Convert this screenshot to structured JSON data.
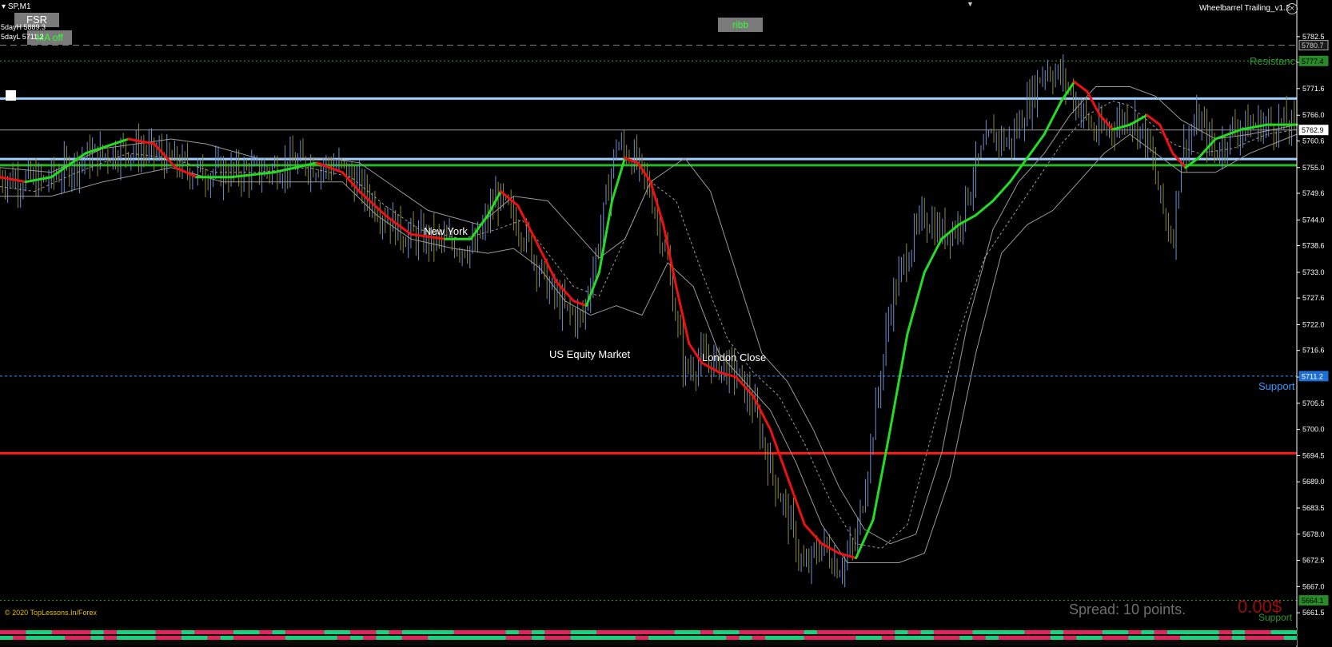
{
  "window": {
    "symbol": "SP,M1",
    "indicator_title": "Wheelbarrel Trailing_v1.2"
  },
  "buttons": {
    "fsr": "FSR",
    "ma_off": "MA off",
    "ribb": "ribb"
  },
  "stats": {
    "five_day_high": "5dayH 5889.3",
    "five_day_low": "5dayL 5711.2"
  },
  "sessions": {
    "new_york": "New York",
    "us_equity": "US Equity Market",
    "london_close": "London Close"
  },
  "levels": {
    "resistance": "Resistance",
    "support": "Support",
    "support_bottom": "Support"
  },
  "footer": {
    "copyright": "© 2020 TopLessons.In/Forex",
    "spread": "Spread: 10 points.",
    "pnl": "0.00$"
  },
  "colors": {
    "bg": "#000000",
    "up_candle": "#6f8fcf",
    "down_candle": "#8c8a32",
    "ma_up": "#22dd22",
    "ma_down": "#ee1111",
    "level_blue": "#9fd0ff",
    "level_green": "#22bb22",
    "level_red": "#ff1a1a",
    "support_blue": "#3399ff",
    "resistance_green": "#2e9a2e"
  },
  "chart_data": {
    "type": "line",
    "symbol": "SP",
    "timeframe": "M1",
    "ylim": [
      5658.5,
      5785.5
    ],
    "y_ticks": [
      5782.5,
      5777.1,
      5771.6,
      5766.0,
      5760.6,
      5755.0,
      5749.6,
      5744.0,
      5738.6,
      5733.0,
      5727.6,
      5722.0,
      5716.6,
      5711.0,
      5705.5,
      5700.0,
      5694.5,
      5689.0,
      5683.5,
      5678.0,
      5672.5,
      5667.0,
      5661.5
    ],
    "price_tags": [
      {
        "value": 5780.7,
        "label": "5780.7",
        "style": "dark"
      },
      {
        "value": 5777.4,
        "label": "5777.4",
        "style": "green"
      },
      {
        "value": 5762.9,
        "label": "5762.9",
        "style": "white"
      },
      {
        "value": 5711.2,
        "label": "5711.2",
        "style": "blue"
      },
      {
        "value": 5664.1,
        "label": "5664.1",
        "style": "green"
      }
    ],
    "horizontal_levels": [
      {
        "value": 5780.7,
        "style": "dash-gray"
      },
      {
        "value": 5777.4,
        "style": "dot-green"
      },
      {
        "value": 5769.5,
        "style": "solid-lightblue"
      },
      {
        "value": 5762.9,
        "style": "solid-gray"
      },
      {
        "value": 5756.8,
        "style": "solid-lightblue"
      },
      {
        "value": 5755.5,
        "style": "solid-green"
      },
      {
        "value": 5711.2,
        "style": "dot-blue"
      },
      {
        "value": 5695.0,
        "style": "solid-red"
      },
      {
        "value": 5664.1,
        "style": "dot-green"
      }
    ],
    "price_anchors": [
      [
        0,
        5753
      ],
      [
        50,
        5752
      ],
      [
        100,
        5757
      ],
      [
        150,
        5759
      ],
      [
        180,
        5758
      ],
      [
        230,
        5754
      ],
      [
        300,
        5754
      ],
      [
        350,
        5756
      ],
      [
        400,
        5755
      ],
      [
        430,
        5749
      ],
      [
        470,
        5741
      ],
      [
        500,
        5740
      ],
      [
        530,
        5739
      ],
      [
        555,
        5738
      ],
      [
        580,
        5749
      ],
      [
        610,
        5742
      ],
      [
        640,
        5730
      ],
      [
        660,
        5725
      ],
      [
        680,
        5723
      ],
      [
        700,
        5740
      ],
      [
        720,
        5760
      ],
      [
        740,
        5757
      ],
      [
        760,
        5750
      ],
      [
        780,
        5735
      ],
      [
        800,
        5712
      ],
      [
        820,
        5715
      ],
      [
        860,
        5712
      ],
      [
        880,
        5705
      ],
      [
        900,
        5692
      ],
      [
        920,
        5682
      ],
      [
        940,
        5670
      ],
      [
        960,
        5676
      ],
      [
        980,
        5671
      ],
      [
        1000,
        5676
      ],
      [
        1020,
        5700
      ],
      [
        1040,
        5726
      ],
      [
        1060,
        5737
      ],
      [
        1080,
        5745
      ],
      [
        1100,
        5741
      ],
      [
        1120,
        5743
      ],
      [
        1140,
        5755
      ],
      [
        1160,
        5762
      ],
      [
        1180,
        5760
      ],
      [
        1200,
        5768
      ],
      [
        1220,
        5776
      ],
      [
        1240,
        5774
      ],
      [
        1260,
        5768
      ],
      [
        1280,
        5762
      ],
      [
        1300,
        5764
      ],
      [
        1320,
        5766
      ],
      [
        1340,
        5761
      ],
      [
        1360,
        5745
      ],
      [
        1370,
        5740
      ],
      [
        1380,
        5758
      ],
      [
        1400,
        5765
      ],
      [
        1420,
        5758
      ],
      [
        1440,
        5763
      ],
      [
        1470,
        5764
      ],
      [
        1500,
        5764
      ],
      [
        1515,
        5763
      ]
    ],
    "ma_fast": [
      [
        0,
        5753
      ],
      [
        30,
        5752
      ],
      [
        60,
        5753
      ],
      [
        100,
        5758
      ],
      [
        150,
        5761
      ],
      [
        180,
        5760
      ],
      [
        205,
        5755
      ],
      [
        230,
        5753
      ],
      [
        270,
        5753
      ],
      [
        320,
        5754
      ],
      [
        370,
        5756
      ],
      [
        400,
        5754
      ],
      [
        420,
        5750
      ],
      [
        450,
        5745
      ],
      [
        480,
        5741
      ],
      [
        520,
        5740
      ],
      [
        550,
        5740
      ],
      [
        570,
        5745
      ],
      [
        585,
        5750
      ],
      [
        605,
        5747
      ],
      [
        625,
        5740
      ],
      [
        650,
        5731
      ],
      [
        670,
        5727
      ],
      [
        685,
        5726
      ],
      [
        700,
        5733
      ],
      [
        715,
        5748
      ],
      [
        730,
        5757
      ],
      [
        745,
        5756
      ],
      [
        760,
        5752
      ],
      [
        775,
        5743
      ],
      [
        790,
        5730
      ],
      [
        805,
        5718
      ],
      [
        820,
        5714
      ],
      [
        840,
        5712
      ],
      [
        860,
        5711
      ],
      [
        880,
        5707
      ],
      [
        900,
        5700
      ],
      [
        920,
        5690
      ],
      [
        940,
        5680
      ],
      [
        960,
        5676
      ],
      [
        980,
        5674
      ],
      [
        1000,
        5673
      ],
      [
        1020,
        5681
      ],
      [
        1040,
        5700
      ],
      [
        1060,
        5720
      ],
      [
        1080,
        5733
      ],
      [
        1100,
        5740
      ],
      [
        1120,
        5743
      ],
      [
        1140,
        5745
      ],
      [
        1160,
        5748
      ],
      [
        1180,
        5752
      ],
      [
        1200,
        5757
      ],
      [
        1220,
        5762
      ],
      [
        1240,
        5769
      ],
      [
        1255,
        5773
      ],
      [
        1270,
        5771
      ],
      [
        1285,
        5766
      ],
      [
        1300,
        5763
      ],
      [
        1320,
        5764
      ],
      [
        1340,
        5766
      ],
      [
        1355,
        5764
      ],
      [
        1370,
        5758
      ],
      [
        1385,
        5755
      ],
      [
        1400,
        5757
      ],
      [
        1420,
        5761
      ],
      [
        1450,
        5763
      ],
      [
        1480,
        5764
      ],
      [
        1515,
        5764
      ]
    ],
    "ribbon_mid": [
      [
        0,
        5751
      ],
      [
        40,
        5750
      ],
      [
        90,
        5754
      ],
      [
        150,
        5758
      ],
      [
        200,
        5757
      ],
      [
        250,
        5754
      ],
      [
        300,
        5754
      ],
      [
        360,
        5755
      ],
      [
        410,
        5753
      ],
      [
        450,
        5747
      ],
      [
        490,
        5742
      ],
      [
        540,
        5740
      ],
      [
        580,
        5742
      ],
      [
        610,
        5744
      ],
      [
        640,
        5737
      ],
      [
        670,
        5730
      ],
      [
        700,
        5728
      ],
      [
        730,
        5740
      ],
      [
        760,
        5752
      ],
      [
        790,
        5748
      ],
      [
        820,
        5733
      ],
      [
        850,
        5719
      ],
      [
        880,
        5712
      ],
      [
        910,
        5707
      ],
      [
        940,
        5697
      ],
      [
        970,
        5685
      ],
      [
        1000,
        5676
      ],
      [
        1030,
        5675
      ],
      [
        1060,
        5680
      ],
      [
        1090,
        5700
      ],
      [
        1120,
        5720
      ],
      [
        1150,
        5736
      ],
      [
        1180,
        5744
      ],
      [
        1210,
        5752
      ],
      [
        1240,
        5760
      ],
      [
        1270,
        5766
      ],
      [
        1300,
        5769
      ],
      [
        1320,
        5768
      ],
      [
        1340,
        5765
      ],
      [
        1370,
        5760
      ],
      [
        1400,
        5758
      ],
      [
        1440,
        5759
      ],
      [
        1480,
        5762
      ],
      [
        1515,
        5763
      ]
    ],
    "ribbon_upper": [
      [
        0,
        5755
      ],
      [
        60,
        5754
      ],
      [
        120,
        5759
      ],
      [
        200,
        5761
      ],
      [
        240,
        5760
      ],
      [
        300,
        5757
      ],
      [
        380,
        5757
      ],
      [
        420,
        5756
      ],
      [
        460,
        5751
      ],
      [
        500,
        5746
      ],
      [
        560,
        5743
      ],
      [
        600,
        5749
      ],
      [
        640,
        5748
      ],
      [
        670,
        5742
      ],
      [
        700,
        5736
      ],
      [
        730,
        5740
      ],
      [
        760,
        5752
      ],
      [
        800,
        5757
      ],
      [
        830,
        5750
      ],
      [
        860,
        5733
      ],
      [
        890,
        5716
      ],
      [
        920,
        5710
      ],
      [
        950,
        5700
      ],
      [
        980,
        5688
      ],
      [
        1010,
        5679
      ],
      [
        1040,
        5676
      ],
      [
        1070,
        5678
      ],
      [
        1100,
        5695
      ],
      [
        1130,
        5722
      ],
      [
        1160,
        5742
      ],
      [
        1190,
        5752
      ],
      [
        1220,
        5758
      ],
      [
        1250,
        5766
      ],
      [
        1280,
        5772
      ],
      [
        1320,
        5772
      ],
      [
        1350,
        5770
      ],
      [
        1380,
        5765
      ],
      [
        1420,
        5761
      ],
      [
        1460,
        5762
      ],
      [
        1515,
        5764
      ]
    ],
    "ribbon_lower": [
      [
        0,
        5749
      ],
      [
        60,
        5749
      ],
      [
        120,
        5752
      ],
      [
        200,
        5755
      ],
      [
        260,
        5752
      ],
      [
        330,
        5752
      ],
      [
        400,
        5752
      ],
      [
        440,
        5745
      ],
      [
        480,
        5740
      ],
      [
        530,
        5738
      ],
      [
        570,
        5737
      ],
      [
        600,
        5738
      ],
      [
        630,
        5734
      ],
      [
        660,
        5727
      ],
      [
        690,
        5724
      ],
      [
        720,
        5726
      ],
      [
        750,
        5724
      ],
      [
        780,
        5735
      ],
      [
        810,
        5730
      ],
      [
        840,
        5716
      ],
      [
        870,
        5710
      ],
      [
        900,
        5704
      ],
      [
        930,
        5693
      ],
      [
        960,
        5680
      ],
      [
        990,
        5672
      ],
      [
        1020,
        5672
      ],
      [
        1050,
        5672
      ],
      [
        1080,
        5674
      ],
      [
        1110,
        5690
      ],
      [
        1140,
        5716
      ],
      [
        1170,
        5737
      ],
      [
        1200,
        5743
      ],
      [
        1230,
        5746
      ],
      [
        1260,
        5752
      ],
      [
        1290,
        5758
      ],
      [
        1320,
        5762
      ],
      [
        1350,
        5758
      ],
      [
        1380,
        5754
      ],
      [
        1420,
        5754
      ],
      [
        1460,
        5758
      ],
      [
        1515,
        5762
      ]
    ],
    "bottom_strip_pattern": [
      1,
      1,
      0,
      0,
      1,
      1,
      1,
      0,
      1,
      0,
      0,
      0,
      1,
      1,
      0,
      1,
      1,
      1,
      0,
      0,
      1,
      0,
      1,
      1,
      1,
      0,
      0,
      1,
      1,
      0,
      1,
      0,
      0,
      0,
      0,
      1,
      1,
      1,
      1,
      0,
      1,
      0,
      1,
      1,
      0,
      0,
      1,
      1,
      1,
      1,
      1,
      1,
      0,
      0,
      1,
      0,
      0,
      1,
      1,
      1,
      1,
      1,
      0,
      1,
      1,
      1,
      1,
      1,
      1,
      0,
      1,
      0,
      1,
      1,
      1,
      0,
      0,
      0,
      0,
      1,
      1,
      0,
      1,
      1,
      1,
      0,
      0,
      1,
      0,
      1,
      0,
      0,
      0,
      0,
      1,
      0,
      1,
      1,
      0,
      0
    ]
  }
}
